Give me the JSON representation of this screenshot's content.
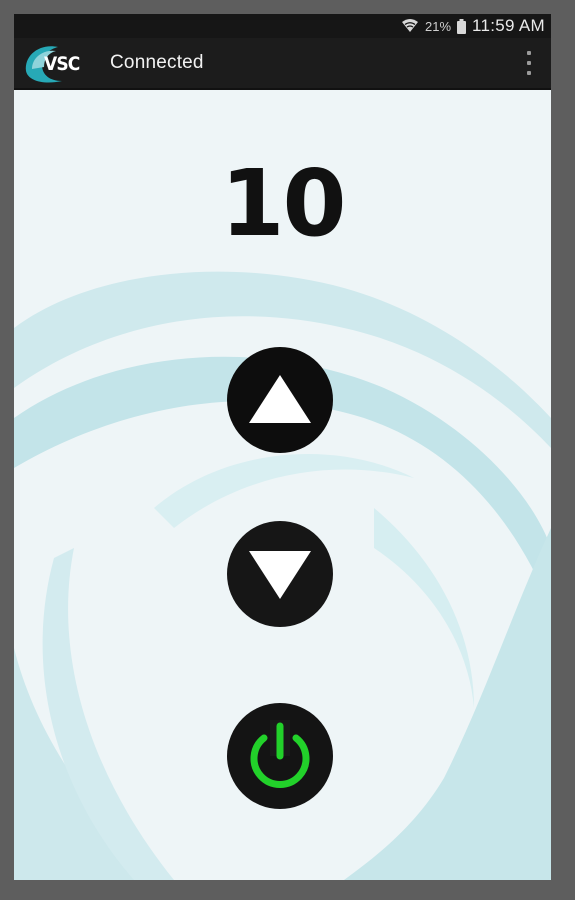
{
  "status_bar": {
    "battery_percent": "21%",
    "time": "11:59 AM",
    "icons": [
      "wifi-icon",
      "battery-icon"
    ]
  },
  "action_bar": {
    "logo_text": "VSC",
    "status": "Connected",
    "menu_icon": "overflow-menu-icon"
  },
  "main": {
    "value": "10",
    "up_icon": "triangle-up-icon",
    "down_icon": "triangle-down-icon",
    "power_icon": "power-icon"
  },
  "colors": {
    "accent_teal": "#27a9b6",
    "power_green": "#22d12a",
    "wave": "#c7e6ea",
    "background": "#eef5f7"
  }
}
